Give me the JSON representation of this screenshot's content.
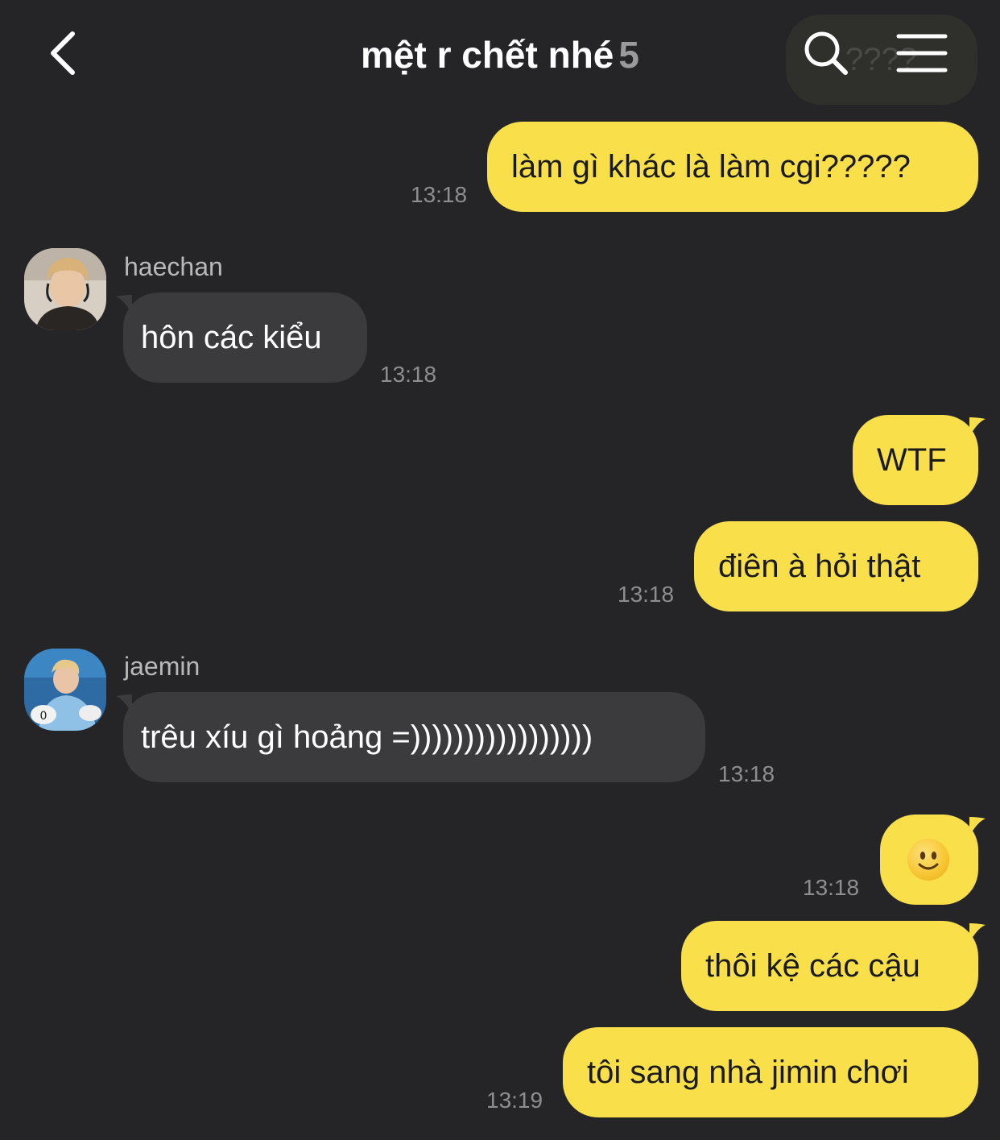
{
  "header": {
    "title": "mệt r chết nhé",
    "member_count": "5",
    "back_icon": "chevron-left-icon",
    "search_icon": "search-icon",
    "menu_icon": "hamburger-menu-icon"
  },
  "colors": {
    "background": "#252527",
    "my_bubble": "#f9e04b",
    "their_bubble": "#3b3b3e",
    "timestamp": "#8e8e90"
  },
  "partial_top_message": "????",
  "messages": [
    {
      "text": "làm gì khác là làm cgi?????",
      "time": "13:18"
    },
    {
      "sender": "haechan",
      "text": "hôn các kiểu",
      "time": "13:18"
    },
    {
      "text": "WTF"
    },
    {
      "text": "điên à hỏi thật",
      "time": "13:18"
    },
    {
      "sender": "jaemin",
      "text": "trêu xíu gì hoảng =)))))))))))))))))",
      "time": "13:18"
    },
    {
      "emoji": "slightly-smiling-face",
      "time": "13:18"
    },
    {
      "text": "thôi kệ các cậu"
    },
    {
      "text": "tôi sang nhà jimin chơi",
      "time": "13:19"
    }
  ]
}
